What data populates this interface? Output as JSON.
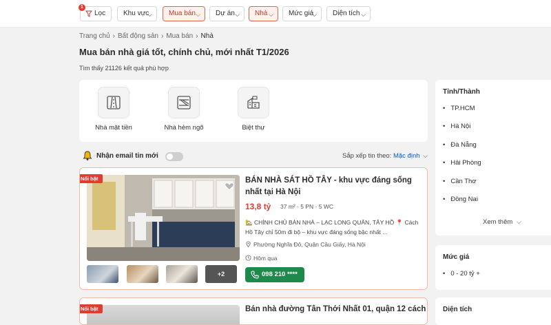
{
  "filters": {
    "filter_label": "Lọc",
    "filter_count": "1",
    "items": [
      {
        "label": "Khu vực",
        "active": false
      },
      {
        "label": "Mua bán",
        "active": true
      },
      {
        "label": "Dự án",
        "active": false
      },
      {
        "label": "Nhà",
        "active": true
      },
      {
        "label": "Mức giá",
        "active": false
      },
      {
        "label": "Diện tích",
        "active": false
      }
    ]
  },
  "breadcrumb": [
    "Trang chủ",
    "Bất động sản",
    "Mua bán",
    "Nhà"
  ],
  "page": {
    "title": "Mua bán nhà giá tốt, chính chủ, mới nhất T1/2026",
    "result_count": "Tìm thấy 21126 kết quả phù hợp"
  },
  "categories": [
    {
      "label": "Nhà mặt tiền",
      "icon": "street-house-icon"
    },
    {
      "label": "Nhà hẻm ngõ",
      "icon": "alley-house-icon"
    },
    {
      "label": "Biệt thự",
      "icon": "villa-icon"
    }
  ],
  "notify": {
    "label": "Nhận email tin mới",
    "enabled": false
  },
  "sort": {
    "label": "Sắp xếp tin theo:",
    "value": "Mặc định"
  },
  "listings": [
    {
      "badge": "Nổi bật",
      "title": "BÁN NHÀ SÁT HỒ TÂY - khu vực đáng sống nhất tại Hà Nội",
      "price": "13,8 tỷ",
      "specs": "37 m² · 5 PN · 5 WC",
      "description": "🏡 CHÍNH CHỦ BÁN NHÀ – LẠC LONG QUÂN, TÂY HỒ 📍 Cách Hồ Tây chỉ 50m đi bộ – khu vực đáng sống bậc nhất ...",
      "location": "Phường Nghĩa Đô, Quận Cầu Giấy, Hà Nội",
      "posted": "Hôm qua",
      "phone": "098 210 ****",
      "more_photos": "+2"
    },
    {
      "badge": "Nổi bật",
      "title": "Bán nhà đường Tân Thới Nhất 01, quận 12 cách"
    }
  ],
  "sidebar": {
    "province": {
      "title": "Tỉnh/Thành",
      "items": [
        "TP.HCM",
        "Hà Nội",
        "Đà Nẵng",
        "Hải Phòng",
        "Cần Thơ",
        "Đồng Nai"
      ],
      "see_more": "Xem thêm"
    },
    "price": {
      "title": "Mức giá",
      "items": [
        "0 - 20 tỷ +"
      ]
    },
    "area": {
      "title": "Diện tích"
    }
  },
  "colors": {
    "accent": "#e03c31",
    "link": "#0e59c5",
    "call": "#1d8a4c"
  }
}
